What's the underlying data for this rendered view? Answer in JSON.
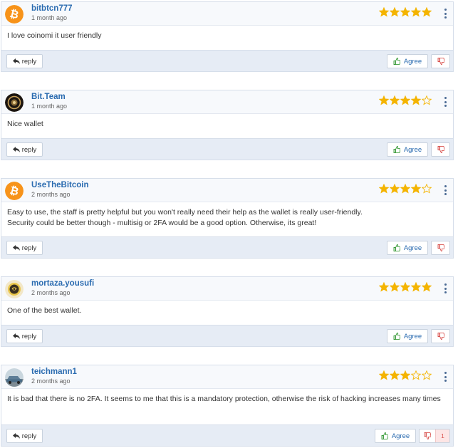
{
  "colors": {
    "star_filled": "#f4b400",
    "username": "#2a6bb0",
    "footer_bg": "#e6ecf5",
    "agree_icon": "#3b9c3b",
    "disagree_icon": "#d9534f"
  },
  "buttons": {
    "reply_label": "reply",
    "agree_label": "Agree"
  },
  "reviews": [
    {
      "username": "bitbtcn777",
      "time": "1 month ago",
      "rating": 5,
      "text": "I love coinomi it user friendly",
      "avatar_icon": "bitcoin-logo-icon"
    },
    {
      "username": "Bit.Team",
      "time": "1 month ago",
      "rating": 4,
      "text": "Nice wallet",
      "avatar_icon": "bit-team-logo-icon"
    },
    {
      "username": "UseTheBitcoin",
      "time": "2 months ago",
      "rating": 4,
      "text": "Easy to use, the staff is pretty helpful but you won't really need their help as the wallet is really user-friendly.\nSecurity could be better though - multisig or 2FA would be a good option. Otherwise, its great!",
      "avatar_icon": "bitcoin-logo-icon"
    },
    {
      "username": "mortaza.yousufi",
      "time": "2 months ago",
      "rating": 5,
      "text": "One of the best wallet.",
      "avatar_icon": "emblem-avatar-icon"
    },
    {
      "username": "teichmann1",
      "time": "2 months ago",
      "rating": 3,
      "text": "It is bad that there is no 2FA. It seems to me that this is a mandatory protection, otherwise the risk of hacking increases many times",
      "avatar_icon": "car-photo-avatar-icon",
      "dislike_count": "1"
    }
  ]
}
